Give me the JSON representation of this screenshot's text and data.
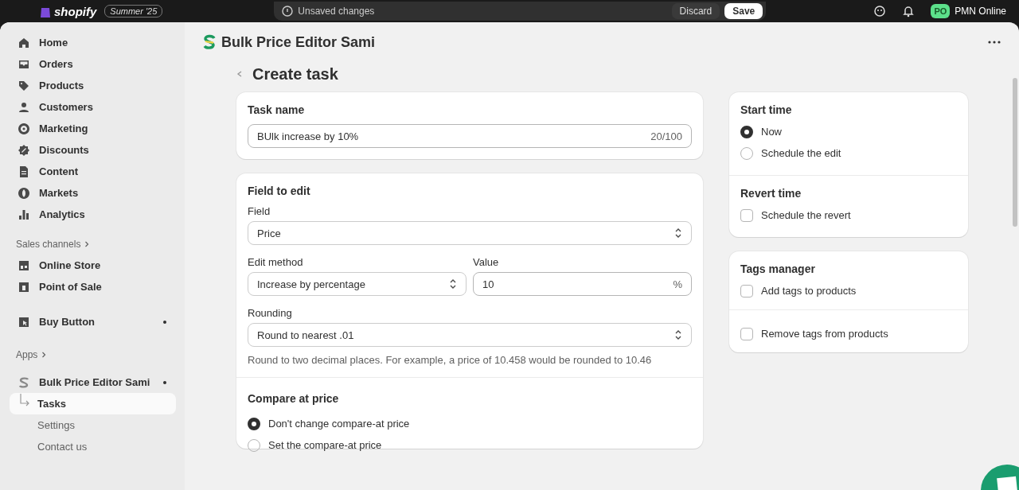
{
  "top_bar": {
    "logo": "shopify",
    "edition": "Summer '25",
    "notice": "Unsaved changes",
    "discard": "Discard",
    "save": "Save",
    "avatar": "PO",
    "store": "PMN Online"
  },
  "sidebar": {
    "items": [
      {
        "label": "Home",
        "selected": false
      },
      {
        "label": "Orders",
        "selected": false
      },
      {
        "label": "Products",
        "selected": false
      },
      {
        "label": "Customers",
        "selected": false
      },
      {
        "label": "Marketing",
        "selected": false
      },
      {
        "label": "Discounts",
        "selected": false
      },
      {
        "label": "Content",
        "selected": false
      },
      {
        "label": "Markets",
        "selected": false
      },
      {
        "label": "Analytics",
        "selected": false
      }
    ],
    "sales_channels": {
      "title": "Sales channels",
      "items": [
        {
          "label": "Online Store",
          "dot": false
        },
        {
          "label": "Point of Sale",
          "dot": false
        },
        {
          "label": "Buy Button",
          "dot": true
        }
      ]
    },
    "apps": {
      "title": "Apps",
      "items": [
        {
          "label": "Bulk Price Editor Sami",
          "dot": true,
          "children": [
            {
              "label": "Tasks",
              "selected": true
            },
            {
              "label": "Settings",
              "selected": false
            },
            {
              "label": "Contact us",
              "selected": false
            }
          ]
        }
      ]
    }
  },
  "app_header": {
    "title": "Bulk Price Editor Sami"
  },
  "page": {
    "title": "Create task"
  },
  "task_name": {
    "title": "Task name",
    "value": "BUlk increase by 10%",
    "counter": "20/100"
  },
  "field_to_edit": {
    "title": "Field to edit",
    "field": {
      "label": "Field",
      "value": "Price"
    },
    "edit_method": {
      "label": "Edit method",
      "value": "Increase by percentage"
    },
    "value": {
      "label": "Value",
      "value": "10",
      "suffix": "%"
    },
    "rounding": {
      "label": "Rounding",
      "value": "Round to nearest .01"
    },
    "help": "Round to two decimal places. For example, a price of 10.458 would be rounded to 10.46"
  },
  "compare_at_price": {
    "title": "Compare at price",
    "options": [
      {
        "label": "Don't change compare-at price",
        "selected": true
      },
      {
        "label": "Set the compare-at price",
        "selected": false
      }
    ]
  },
  "start_time": {
    "title": "Start time",
    "options": [
      {
        "label": "Now",
        "selected": true
      },
      {
        "label": "Schedule the edit",
        "selected": false
      }
    ]
  },
  "revert_time": {
    "title": "Revert time",
    "options": [
      {
        "label": "Schedule the revert",
        "checked": false
      }
    ]
  },
  "tags_manager": {
    "title": "Tags manager",
    "options": [
      {
        "label": "Add tags to products",
        "checked": false
      },
      {
        "label": "Remove tags from products",
        "checked": false
      }
    ]
  }
}
